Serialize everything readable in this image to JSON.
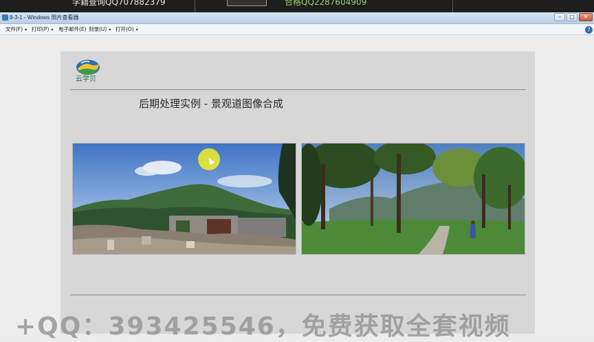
{
  "overlay": {
    "left_text": "学籍查询QQ707882379",
    "right_text": "合格QQ2287604909"
  },
  "window": {
    "title": "8-3-1 - Windows 照片查看器",
    "controls": {
      "minimize": "–",
      "maximize": "□",
      "close": "✕",
      "help": "?"
    }
  },
  "menu": {
    "items": [
      {
        "label": "文件(F)"
      },
      {
        "label": "打印(P)"
      },
      {
        "label": "电子邮件(E)"
      },
      {
        "label": "刻录(U)"
      },
      {
        "label": "打开(O)"
      }
    ],
    "caret": "▾"
  },
  "slide": {
    "logo_text": "云学贝",
    "title": "后期处理实例 - 景观道图像合成",
    "logo_colors": {
      "blue": "#2a6fb0",
      "green": "#3f9b4a",
      "yellow": "#f0c23a"
    }
  },
  "images": {
    "before_icon": "mountain-ruins-photo",
    "after_icon": "tree-lined-path-photo"
  },
  "watermark": "+QQ：393425546，免费获取全套视频"
}
